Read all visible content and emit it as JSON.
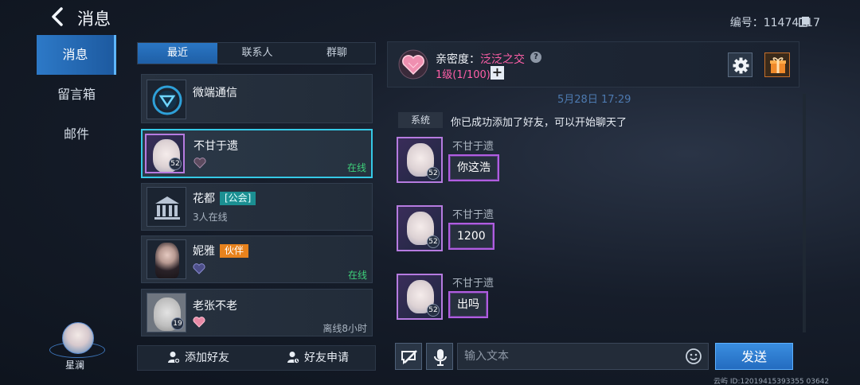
{
  "header": {
    "title": "消息",
    "account_id": "编号：11474117"
  },
  "left_menu": {
    "items": [
      {
        "label": "消息",
        "active": true
      },
      {
        "label": "留言箱",
        "active": false
      },
      {
        "label": "邮件",
        "active": false
      }
    ],
    "player_name": "星澜"
  },
  "tabs": [
    {
      "label": "最近",
      "active": true
    },
    {
      "label": "联系人",
      "active": false
    },
    {
      "label": "群聊",
      "active": false
    }
  ],
  "chat_list": [
    {
      "name": "微端通信",
      "sub": "",
      "status": "",
      "tag": ""
    },
    {
      "name": "不甘于遗",
      "sub": "",
      "status": "在线",
      "tag": "",
      "level": "52"
    },
    {
      "name": "花都",
      "sub": "3人在线",
      "status": "",
      "tag": "[公会]"
    },
    {
      "name": "妮雅",
      "sub": "",
      "status": "在线",
      "tag": "伙伴"
    },
    {
      "name": "老张不老",
      "sub": "",
      "status": "离线8小时",
      "tag": "",
      "level": "19"
    }
  ],
  "bottom_actions": {
    "add_friend": "添加好友",
    "friend_requests": "好友申请"
  },
  "conversation": {
    "intimacy_label": "亲密度：",
    "intimacy_value": "泛泛之交",
    "intimacy_level": "1级(1/100)",
    "date_line": "5月28日 17:29",
    "system_tag": "系统",
    "system_text": "你已成功添加了好友，可以开始聊天了",
    "messages": [
      {
        "sender": "不甘于遗",
        "text": "你这浩",
        "level": "52"
      },
      {
        "sender": "不甘于遗",
        "text": "1200",
        "level": "52"
      },
      {
        "sender": "不甘于遗",
        "text": "出吗",
        "level": "52"
      }
    ]
  },
  "input": {
    "placeholder": "输入文本",
    "send_label": "发送"
  },
  "footer": {
    "id_text": "云屿 ID:12019415393355 03642"
  },
  "colors": {
    "accent": "#2a76c4",
    "selected_border": "#35c9e6",
    "intimacy": "#ff5fa8",
    "online": "#3ed07a",
    "bubble_border": "#b05de0"
  }
}
